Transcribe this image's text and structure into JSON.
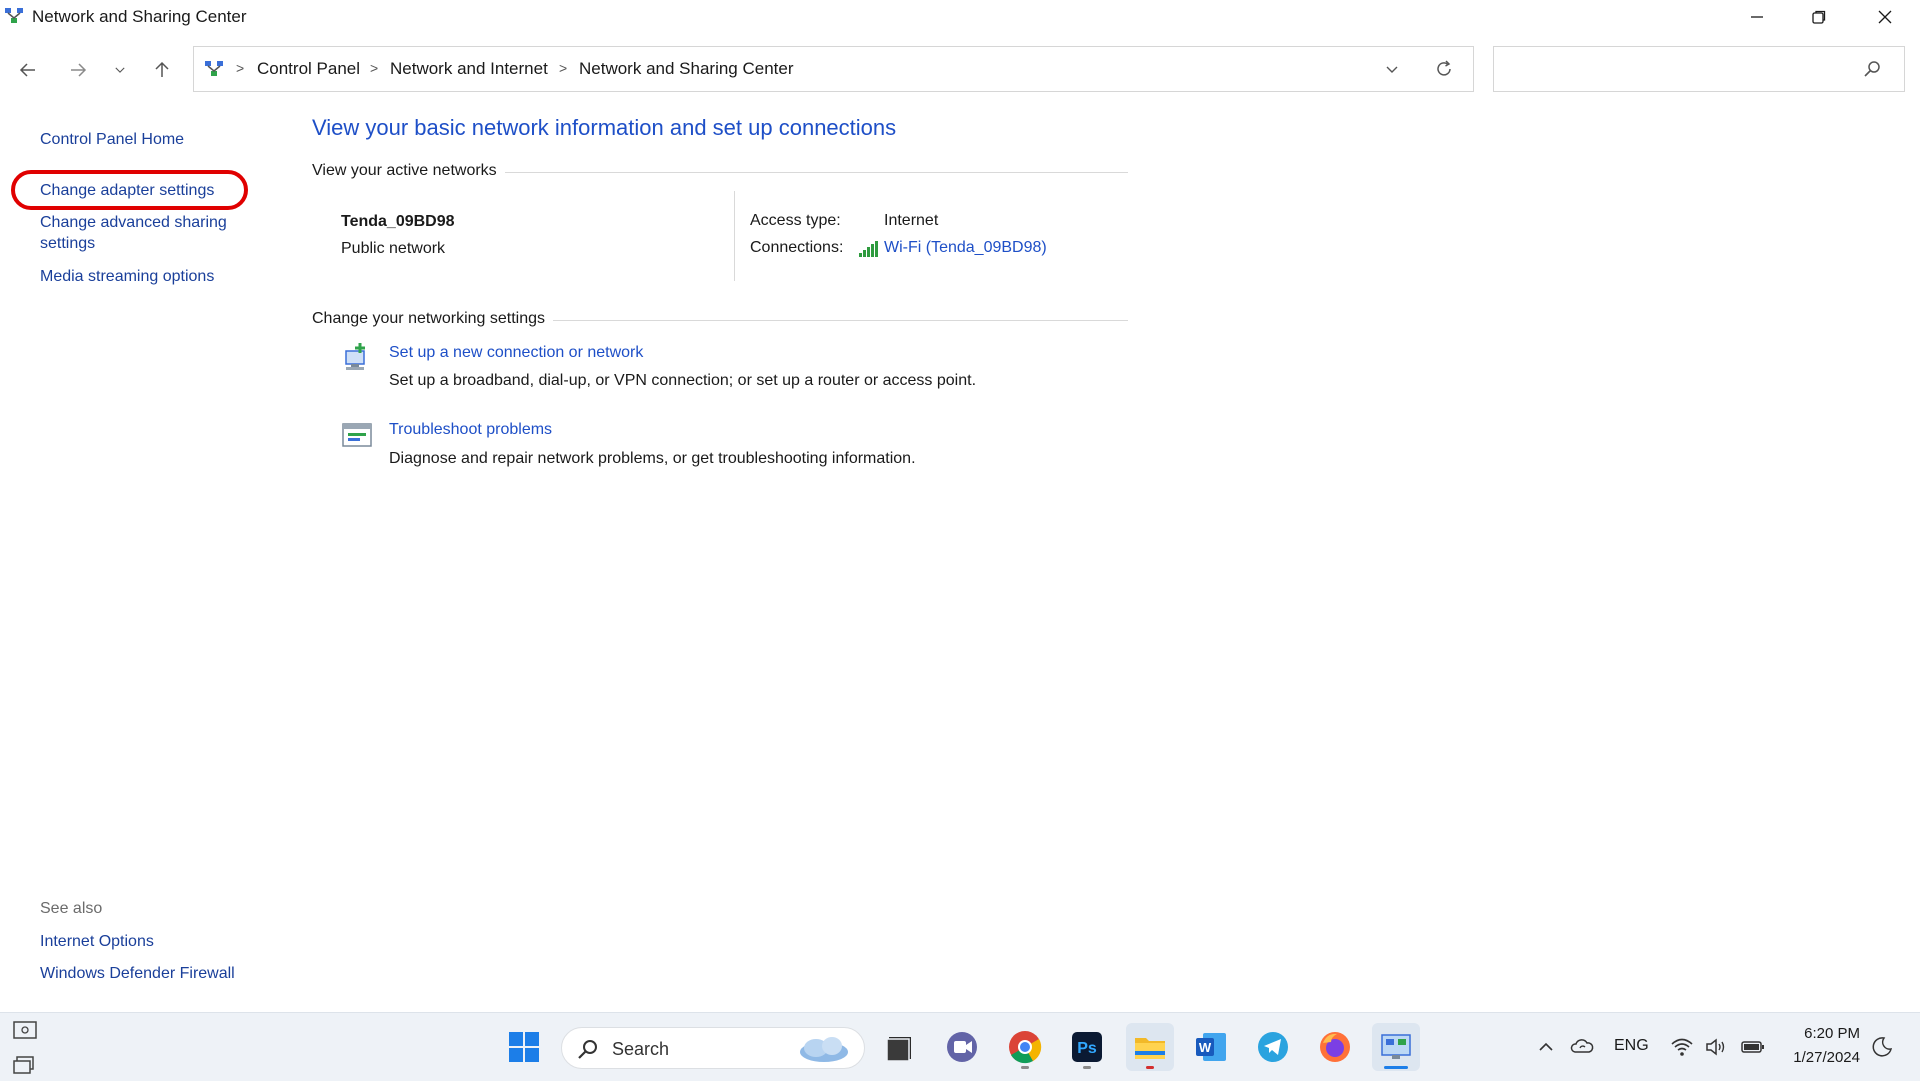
{
  "window": {
    "title": "Network and Sharing Center",
    "minimize_icon": "minimize-icon",
    "maximize_icon": "restore-icon",
    "close_icon": "close-icon"
  },
  "navigation": {
    "back_icon": "arrow-left-icon",
    "forward_icon": "arrow-right-icon",
    "recent_icon": "chevron-down-icon",
    "up_icon": "arrow-up-icon",
    "breadcrumbs": [
      "Control Panel",
      "Network and Internet",
      "Network and Sharing Center"
    ],
    "search_placeholder": ""
  },
  "left_pane": {
    "links": [
      "Control Panel Home",
      "Change adapter settings",
      "Change advanced sharing",
      "settings",
      "Media streaming options"
    ],
    "see_also_title": "See also",
    "see_also_links": [
      "Internet Options",
      "Windows Defender Firewall"
    ],
    "highlight_color": "#e00000"
  },
  "main": {
    "heading": "View your basic network information and set up connections",
    "active_networks_title": "View your active networks",
    "network": {
      "name": "Tenda_09BD98",
      "type": "Public network",
      "access_type_label": "Access type:",
      "access_type_value": "Internet",
      "connections_label": "Connections:",
      "connection_link": "Wi-Fi (Tenda_09BD98)"
    },
    "change_settings_title": "Change your networking settings",
    "tasks": [
      {
        "link": "Set up a new connection or network",
        "description": "Set up a broadband, dial-up, or VPN connection; or set up a router or access point.",
        "icon": "new-connection-icon"
      },
      {
        "link": "Troubleshoot problems",
        "description": "Diagnose and repair network problems, or get troubleshooting information.",
        "icon": "troubleshoot-icon"
      }
    ]
  },
  "taskbar": {
    "search_label": "Search",
    "apps": [
      "start-icon",
      "file-manager-icon",
      "teams-icon",
      "chrome-icon",
      "photoshop-icon",
      "file-explorer-icon",
      "word-icon",
      "telegram-icon",
      "firefox-icon",
      "control-panel-icon"
    ],
    "photoshop_text": "Ps",
    "word_text": "W",
    "language": "ENG",
    "time": "6:20 PM",
    "date": "1/27/2024"
  },
  "colors": {
    "link": "#1e4fc7",
    "left_link": "#1a3f9a",
    "taskbar_bg": "#eef2f7"
  }
}
